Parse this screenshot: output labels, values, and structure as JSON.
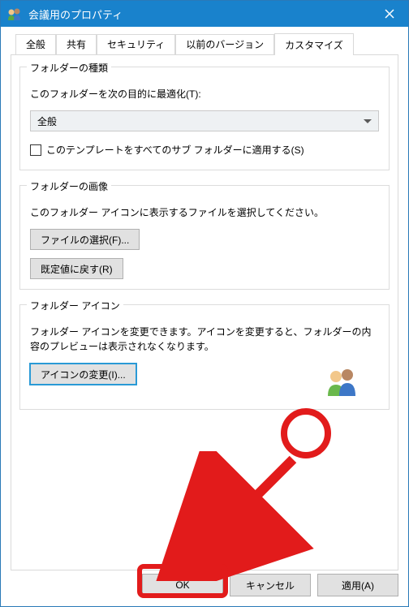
{
  "window": {
    "title": "会議用のプロパティ"
  },
  "tabs": {
    "items": [
      {
        "label": "全般"
      },
      {
        "label": "共有"
      },
      {
        "label": "セキュリティ"
      },
      {
        "label": "以前のバージョン"
      },
      {
        "label": "カスタマイズ"
      }
    ],
    "activeIndex": 4
  },
  "group_type": {
    "legend": "フォルダーの種類",
    "help": "このフォルダーを次の目的に最適化(T):",
    "select_value": "全般",
    "checkbox_label": "このテンプレートをすべてのサブ フォルダーに適用する(S)"
  },
  "group_image": {
    "legend": "フォルダーの画像",
    "help": "このフォルダー アイコンに表示するファイルを選択してください。",
    "btn_choose": "ファイルの選択(F)...",
    "btn_restore": "既定値に戻す(R)"
  },
  "group_icon": {
    "legend": "フォルダー アイコン",
    "help": "フォルダー アイコンを変更できます。アイコンを変更すると、フォルダーの内容のプレビューは表示されなくなります。",
    "btn_change": "アイコンの変更(I)..."
  },
  "buttons": {
    "ok": "OK",
    "cancel": "キャンセル",
    "apply": "適用(A)"
  }
}
